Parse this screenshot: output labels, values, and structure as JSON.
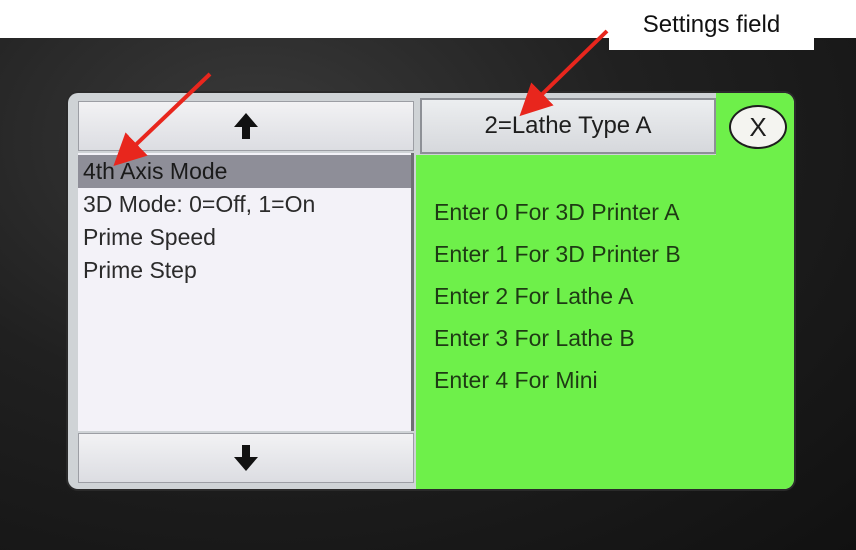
{
  "annotation": {
    "label": "Settings field",
    "arrow_color": "#e8261d"
  },
  "list": {
    "up_icon": "arrow-up-icon",
    "down_icon": "arrow-down-icon",
    "items": [
      {
        "label": "4th Axis Mode",
        "selected": true
      },
      {
        "label": "3D Mode: 0=Off, 1=On",
        "selected": false
      },
      {
        "label": "Prime Speed",
        "selected": false
      },
      {
        "label": "Prime Step",
        "selected": false
      }
    ]
  },
  "settings_field": {
    "value": "2=Lathe Type A"
  },
  "close_button": {
    "label": "X"
  },
  "options": [
    "Enter 0 For 3D Printer A",
    "Enter 1 For 3D Printer B",
    "Enter 2 For Lathe A",
    "Enter 3 For Lathe B",
    "Enter 4 For Mini"
  ],
  "colors": {
    "panel_green": "#6ef04a",
    "list_background": "#f3f2f8",
    "selection": "#8e8e98"
  }
}
